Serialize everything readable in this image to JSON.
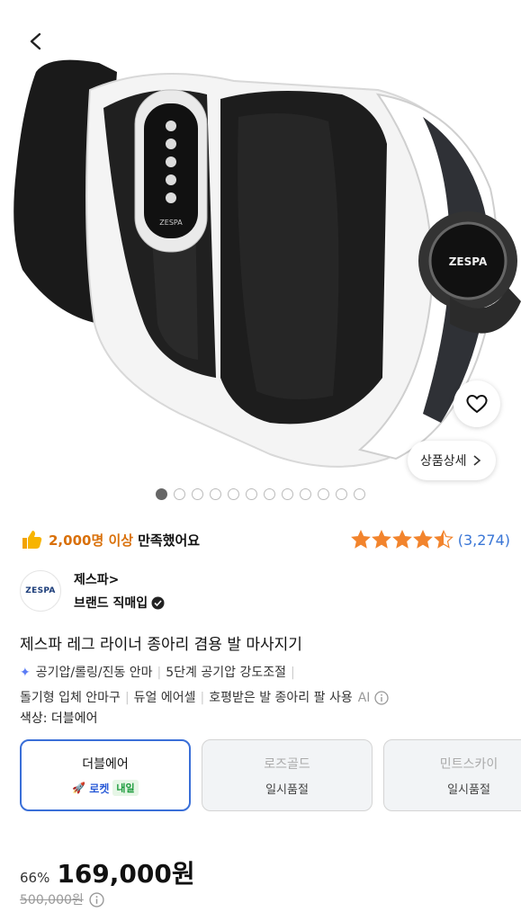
{
  "header": {
    "back_icon": "chevron-left-icon"
  },
  "gallery": {
    "wishlist_icon": "heart-outline-icon",
    "detail_label": "상품상세",
    "image_count": 12,
    "active_index": 0,
    "device_brand_print": "ZESPA"
  },
  "satisfaction": {
    "icon": "thumbs-up-icon",
    "highlight": "2,000명 이상",
    "suffix": "만족했어요"
  },
  "rating": {
    "stars": 4.5,
    "review_count": "(3,274)"
  },
  "brand": {
    "logo_text": "ZESPA",
    "name": "제스파",
    "name_chevron": ">",
    "official": "브랜드 직매입"
  },
  "product": {
    "title": "제스파 레그 라이너 종아리 겸용 발 마사지기",
    "features_line1": [
      "공기압/롤링/진동 안마",
      "5단계 공기압 강도조절"
    ],
    "features_line2": [
      "돌기형 입체 안마구",
      "듀얼 에어셀",
      "호평받은 발 종아리 팔 사용"
    ],
    "ai_label": "AI"
  },
  "options": {
    "label": "색상: 더블에어",
    "items": [
      {
        "name": "더블에어",
        "rocket": "로켓",
        "badge": "내일"
      },
      {
        "name": "로즈골드",
        "status": "일시품절"
      },
      {
        "name": "민트스카이",
        "status": "일시품절"
      }
    ]
  },
  "price": {
    "discount": "66%",
    "sale": "169,000원",
    "original": "500,000원"
  },
  "colors": {
    "accent_blue": "#3a6fd8",
    "orange": "#d9700a",
    "star": "#f2842d"
  }
}
